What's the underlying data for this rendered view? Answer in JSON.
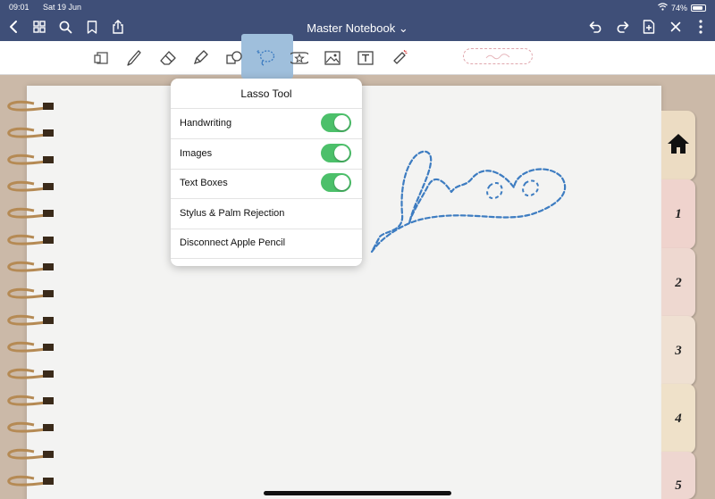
{
  "status": {
    "time": "09:01",
    "date": "Sat 19 Jun",
    "battery": "74%"
  },
  "nav": {
    "title": "Master Notebook ⌄"
  },
  "popup": {
    "title": "Lasso Tool",
    "items": [
      {
        "label": "Handwriting",
        "toggle": true
      },
      {
        "label": "Images",
        "toggle": true
      },
      {
        "label": "Text Boxes",
        "toggle": true
      },
      {
        "label": "Stylus & Palm Rejection",
        "toggle": false
      },
      {
        "label": "Disconnect Apple Pencil",
        "toggle": false
      }
    ]
  },
  "tabs": [
    {
      "label": "⌂",
      "icon": "home-icon",
      "color": "#ecdcc3"
    },
    {
      "label": "1",
      "color": "#efd3cd"
    },
    {
      "label": "2",
      "color": "#eed8d0"
    },
    {
      "label": "3",
      "color": "#efe0d2"
    },
    {
      "label": "4",
      "color": "#efe1c9"
    },
    {
      "label": "5",
      "color": "#eed6d0"
    }
  ],
  "colors": {
    "topbar": "#3f4f78",
    "lasso_stroke": "#3d7cc1",
    "toggle_on": "#4cc06a",
    "lasso_highlight": "#9fbfdc"
  },
  "icons": [
    "back-icon",
    "grid-icon",
    "search-icon",
    "bookmark-icon",
    "share-icon",
    "undo-icon",
    "redo-icon",
    "add-page-icon",
    "close-icon",
    "more-icon",
    "reader-mode-icon",
    "pen-icon",
    "eraser-icon",
    "highlighter-icon",
    "shapes-icon",
    "lasso-icon",
    "sticker-icon",
    "image-icon",
    "text-box-icon",
    "laser-pointer-icon"
  ]
}
